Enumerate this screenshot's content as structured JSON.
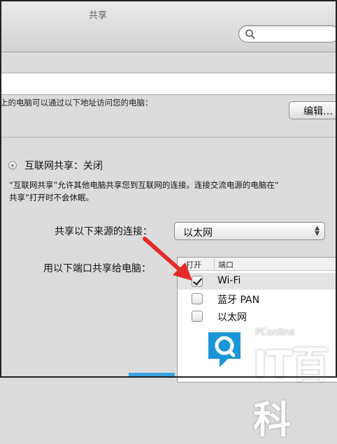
{
  "window": {
    "title": "共享"
  },
  "search": {
    "placeholder": ""
  },
  "access": {
    "text": "上的电脑可以通过以下地址访问您的电脑：",
    "edit_label": "编辑…"
  },
  "internet_sharing": {
    "status": "互联网共享：关闭",
    "description_line1": "“互联网共享”允许其他电脑共享您到互联网的连接。连接交流电源的电脑在“",
    "description_line2": "共享”打开时不会休眠。"
  },
  "share_from": {
    "label": "共享以下来源的连接：",
    "value": "以太网"
  },
  "share_to": {
    "label": "用以下端口共享给电脑：",
    "col_on": "打开",
    "col_port": "端口",
    "ports": [
      {
        "name": "Wi-Fi",
        "checked": true
      },
      {
        "name": "蓝牙 PAN",
        "checked": false
      },
      {
        "name": "以太网",
        "checked": false
      }
    ]
  },
  "watermark": {
    "small": "PConline",
    "brand": "IT百科"
  },
  "colors": {
    "arrow": "#e52a2a",
    "watermark_stripe": "#3aa0e0"
  }
}
